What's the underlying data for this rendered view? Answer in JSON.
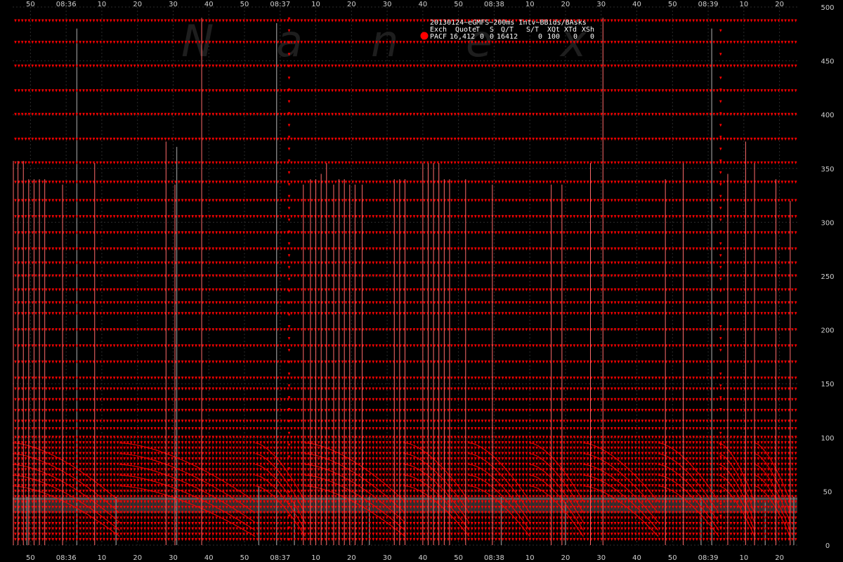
{
  "chart_data": {
    "type": "scatter",
    "title": "20130124~eGMFS~200ms Intv~BBids/BAsks",
    "watermark_letters": [
      "N",
      "a",
      "n",
      "e",
      "x"
    ],
    "legend": {
      "header": [
        "Exch",
        "Quote",
        "T",
        "S",
        "Q/T",
        "S/T",
        "XQt",
        "XTd",
        "XSh"
      ],
      "row": [
        "PACF",
        "16,412",
        "0",
        "0",
        "16412",
        "0",
        "100",
        "0",
        "0"
      ],
      "marker_color": "#ff0000"
    },
    "x_axis": {
      "start_seconds": 45,
      "end_seconds": 265,
      "tick_labels": [
        {
          "t": 50,
          "label": "50"
        },
        {
          "t": 60,
          "label": "08:36"
        },
        {
          "t": 70,
          "label": "10"
        },
        {
          "t": 80,
          "label": "20"
        },
        {
          "t": 90,
          "label": "30"
        },
        {
          "t": 100,
          "label": "40"
        },
        {
          "t": 110,
          "label": "50"
        },
        {
          "t": 120,
          "label": "08:37"
        },
        {
          "t": 130,
          "label": "10"
        },
        {
          "t": 140,
          "label": "20"
        },
        {
          "t": 150,
          "label": "30"
        },
        {
          "t": 160,
          "label": "40"
        },
        {
          "t": 170,
          "label": "50"
        },
        {
          "t": 180,
          "label": "08:38"
        },
        {
          "t": 190,
          "label": "10"
        },
        {
          "t": 200,
          "label": "20"
        },
        {
          "t": 210,
          "label": "30"
        },
        {
          "t": 220,
          "label": "40"
        },
        {
          "t": 230,
          "label": "50"
        },
        {
          "t": 240,
          "label": "08:39"
        },
        {
          "t": 250,
          "label": "10"
        },
        {
          "t": 260,
          "label": "20"
        }
      ]
    },
    "y_axis": {
      "ylim": [
        0,
        500
      ],
      "ticks": [
        0,
        50,
        100,
        150,
        200,
        250,
        300,
        350,
        400,
        450,
        500
      ],
      "position": "right"
    },
    "grid": true,
    "series": [
      {
        "color": "#ff0000",
        "marker": "triangle-down",
        "level_rows": [
          5,
          10,
          15,
          20,
          25,
          30,
          35,
          40,
          45,
          50,
          55,
          60,
          65,
          70,
          75,
          80,
          85,
          90,
          95,
          100,
          108,
          115,
          125,
          135,
          145,
          155,
          170,
          185,
          200,
          215,
          225,
          237,
          250,
          262,
          275,
          290,
          305,
          320,
          337,
          355,
          377,
          400,
          422,
          445,
          467,
          487
        ],
        "spikes": [
          {
            "t": 45.2,
            "y": 357
          },
          {
            "t": 46.5,
            "y": 357
          },
          {
            "t": 48,
            "y": 357
          },
          {
            "t": 49.5,
            "y": 340
          },
          {
            "t": 51,
            "y": 340
          },
          {
            "t": 52.5,
            "y": 340
          },
          {
            "t": 54,
            "y": 340
          },
          {
            "t": 59,
            "y": 335
          },
          {
            "t": 68,
            "y": 355
          },
          {
            "t": 88,
            "y": 375
          },
          {
            "t": 90.5,
            "y": 335
          },
          {
            "t": 98,
            "y": 490
          },
          {
            "t": 126.5,
            "y": 335
          },
          {
            "t": 128.5,
            "y": 340
          },
          {
            "t": 130,
            "y": 340
          },
          {
            "t": 131.5,
            "y": 345
          },
          {
            "t": 133,
            "y": 355
          },
          {
            "t": 135,
            "y": 335
          },
          {
            "t": 136.5,
            "y": 340
          },
          {
            "t": 138,
            "y": 340
          },
          {
            "t": 139.5,
            "y": 335
          },
          {
            "t": 141,
            "y": 335
          },
          {
            "t": 143,
            "y": 335
          },
          {
            "t": 152,
            "y": 340
          },
          {
            "t": 153.5,
            "y": 340
          },
          {
            "t": 155,
            "y": 340
          },
          {
            "t": 160,
            "y": 355
          },
          {
            "t": 161.5,
            "y": 355
          },
          {
            "t": 163,
            "y": 355
          },
          {
            "t": 164.5,
            "y": 355
          },
          {
            "t": 166,
            "y": 340
          },
          {
            "t": 167.5,
            "y": 340
          },
          {
            "t": 172,
            "y": 340
          },
          {
            "t": 179.5,
            "y": 335
          },
          {
            "t": 196,
            "y": 335
          },
          {
            "t": 199,
            "y": 335
          },
          {
            "t": 207,
            "y": 355
          },
          {
            "t": 210.5,
            "y": 490
          },
          {
            "t": 228,
            "y": 340
          },
          {
            "t": 233,
            "y": 355
          },
          {
            "t": 245.5,
            "y": 345
          },
          {
            "t": 250.5,
            "y": 375
          },
          {
            "t": 253,
            "y": 355
          },
          {
            "t": 259,
            "y": 340
          },
          {
            "t": 263,
            "y": 320
          }
        ],
        "dotted_columns": [
          {
            "t": 122.5,
            "y_to": 490
          },
          {
            "t": 243.5,
            "y_to": 485
          }
        ],
        "decay_boundaries": [
          45,
          75,
          113,
          127,
          155,
          173,
          190,
          205,
          226,
          243,
          253,
          263
        ]
      },
      {
        "color": "#808080",
        "marker": "line",
        "spikes": [
          {
            "t": 49,
            "y": 45
          },
          {
            "t": 63,
            "y": 480
          },
          {
            "t": 74,
            "y": 45
          },
          {
            "t": 91,
            "y": 370
          },
          {
            "t": 114,
            "y": 55
          },
          {
            "t": 119,
            "y": 485
          },
          {
            "t": 124,
            "y": 40
          },
          {
            "t": 145,
            "y": 45
          },
          {
            "t": 182,
            "y": 45
          },
          {
            "t": 200,
            "y": 40
          },
          {
            "t": 238,
            "y": 45
          },
          {
            "t": 241,
            "y": 480
          },
          {
            "t": 256,
            "y": 40
          },
          {
            "t": 264,
            "y": 45
          }
        ],
        "base_band": [
          30,
          45
        ]
      }
    ]
  }
}
